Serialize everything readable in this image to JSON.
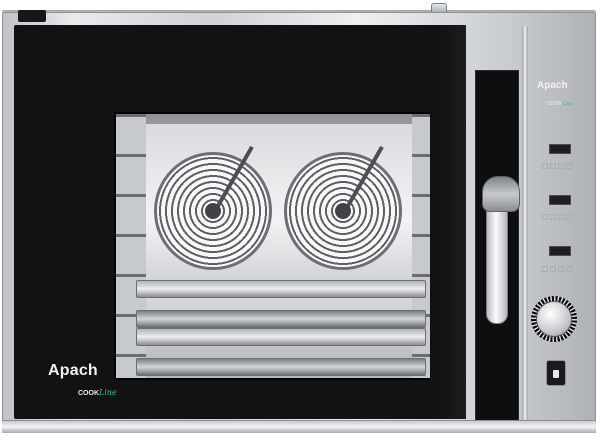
{
  "product": {
    "brand": "Apach",
    "line_word_1": "COOK",
    "line_word_2": "Line"
  },
  "panel": {
    "brand": "Apach",
    "line_word_1": "COOK",
    "line_word_2": "Line",
    "label_a": "",
    "label_b": ""
  },
  "colors": {
    "steel": "#cfd3d6",
    "door": "#111213",
    "accent_green": "#33c07a"
  },
  "icons": {
    "power": "power-icon",
    "usb": "usb-port-icon"
  }
}
